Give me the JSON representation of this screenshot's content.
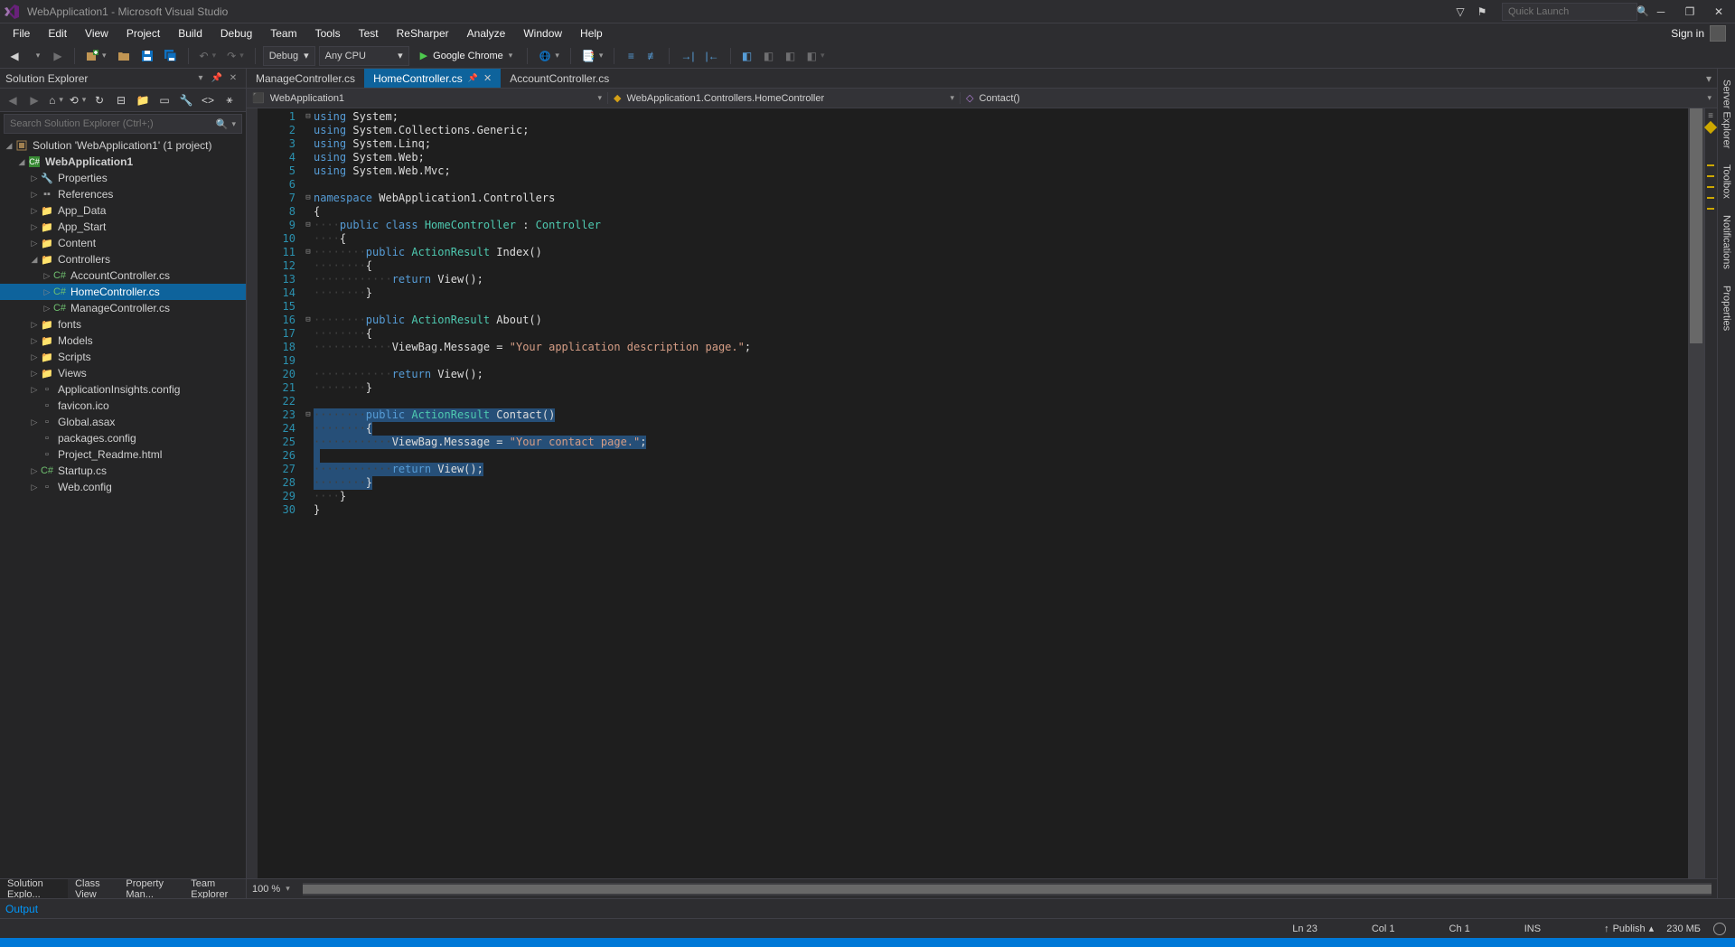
{
  "titlebar": {
    "title": "WebApplication1 - Microsoft Visual Studio",
    "quick_launch_placeholder": "Quick Launch"
  },
  "menubar": {
    "items": [
      "File",
      "Edit",
      "View",
      "Project",
      "Build",
      "Debug",
      "Team",
      "Tools",
      "Test",
      "ReSharper",
      "Analyze",
      "Window",
      "Help"
    ],
    "signin": "Sign in"
  },
  "toolbar": {
    "config": "Debug",
    "platform": "Any CPU",
    "browser": "Google Chrome"
  },
  "solution_explorer": {
    "title": "Solution Explorer",
    "search_placeholder": "Search Solution Explorer (Ctrl+;)",
    "solution": "Solution 'WebApplication1' (1 project)",
    "project": "WebApplication1",
    "nodes": [
      {
        "label": "Properties",
        "indent": 2,
        "chev": "▷",
        "icon": "wrench"
      },
      {
        "label": "References",
        "indent": 2,
        "chev": "▷",
        "icon": "refs"
      },
      {
        "label": "App_Data",
        "indent": 2,
        "chev": "▷",
        "icon": "folder"
      },
      {
        "label": "App_Start",
        "indent": 2,
        "chev": "▷",
        "icon": "folder"
      },
      {
        "label": "Content",
        "indent": 2,
        "chev": "▷",
        "icon": "folder"
      },
      {
        "label": "Controllers",
        "indent": 2,
        "chev": "◢",
        "icon": "folder"
      },
      {
        "label": "AccountController.cs",
        "indent": 3,
        "chev": "▷",
        "icon": "cs"
      },
      {
        "label": "HomeController.cs",
        "indent": 3,
        "chev": "▷",
        "icon": "cs",
        "selected": true
      },
      {
        "label": "ManageController.cs",
        "indent": 3,
        "chev": "▷",
        "icon": "cs"
      },
      {
        "label": "fonts",
        "indent": 2,
        "chev": "▷",
        "icon": "folder"
      },
      {
        "label": "Models",
        "indent": 2,
        "chev": "▷",
        "icon": "folder"
      },
      {
        "label": "Scripts",
        "indent": 2,
        "chev": "▷",
        "icon": "folder"
      },
      {
        "label": "Views",
        "indent": 2,
        "chev": "▷",
        "icon": "folder"
      },
      {
        "label": "ApplicationInsights.config",
        "indent": 2,
        "chev": "▷",
        "icon": "file"
      },
      {
        "label": "favicon.ico",
        "indent": 2,
        "chev": "",
        "icon": "file"
      },
      {
        "label": "Global.asax",
        "indent": 2,
        "chev": "▷",
        "icon": "file"
      },
      {
        "label": "packages.config",
        "indent": 2,
        "chev": "",
        "icon": "file"
      },
      {
        "label": "Project_Readme.html",
        "indent": 2,
        "chev": "",
        "icon": "file"
      },
      {
        "label": "Startup.cs",
        "indent": 2,
        "chev": "▷",
        "icon": "cs"
      },
      {
        "label": "Web.config",
        "indent": 2,
        "chev": "▷",
        "icon": "file"
      }
    ],
    "tabs": [
      "Solution Explo...",
      "Class View",
      "Property Man...",
      "Team Explorer"
    ]
  },
  "editor": {
    "tabs": [
      {
        "label": "ManageController.cs",
        "active": false
      },
      {
        "label": "HomeController.cs",
        "active": true
      },
      {
        "label": "AccountController.cs",
        "active": false
      }
    ],
    "nav": {
      "project": "WebApplication1",
      "class": "WebApplication1.Controllers.HomeController",
      "member": "Contact()"
    },
    "zoom": "100 %",
    "code_lines": [
      {
        "n": 1,
        "fold": "⊟",
        "tokens": [
          {
            "t": "using ",
            "c": "kw"
          },
          {
            "t": "System;",
            "c": ""
          }
        ]
      },
      {
        "n": 2,
        "fold": "",
        "tokens": [
          {
            "t": "using ",
            "c": "kw"
          },
          {
            "t": "System.Collections.Generic;",
            "c": ""
          }
        ]
      },
      {
        "n": 3,
        "fold": "",
        "tokens": [
          {
            "t": "using ",
            "c": "kw"
          },
          {
            "t": "System.Linq;",
            "c": ""
          }
        ]
      },
      {
        "n": 4,
        "fold": "",
        "tokens": [
          {
            "t": "using ",
            "c": "kw"
          },
          {
            "t": "System.Web;",
            "c": ""
          }
        ]
      },
      {
        "n": 5,
        "fold": "",
        "tokens": [
          {
            "t": "using ",
            "c": "kw"
          },
          {
            "t": "System.Web.Mvc;",
            "c": ""
          }
        ]
      },
      {
        "n": 6,
        "fold": "",
        "tokens": []
      },
      {
        "n": 7,
        "fold": "⊟",
        "tokens": [
          {
            "t": "namespace ",
            "c": "kw"
          },
          {
            "t": "WebApplication1.Controllers",
            "c": ""
          }
        ]
      },
      {
        "n": 8,
        "fold": "",
        "tokens": [
          {
            "t": "{",
            "c": ""
          }
        ]
      },
      {
        "n": 9,
        "fold": "⊟",
        "tokens": [
          {
            "t": "    ",
            "c": "dots"
          },
          {
            "t": "public class ",
            "c": "kw"
          },
          {
            "t": "HomeController",
            "c": "type"
          },
          {
            "t": " : ",
            "c": ""
          },
          {
            "t": "Controller",
            "c": "type"
          }
        ]
      },
      {
        "n": 10,
        "fold": "",
        "tokens": [
          {
            "t": "    ",
            "c": "dots"
          },
          {
            "t": "{",
            "c": ""
          }
        ]
      },
      {
        "n": 11,
        "fold": "⊟",
        "tokens": [
          {
            "t": "        ",
            "c": "dots"
          },
          {
            "t": "public ",
            "c": "kw"
          },
          {
            "t": "ActionResult",
            "c": "type"
          },
          {
            "t": " Index()",
            "c": ""
          }
        ]
      },
      {
        "n": 12,
        "fold": "",
        "tokens": [
          {
            "t": "        ",
            "c": "dots"
          },
          {
            "t": "{",
            "c": ""
          }
        ]
      },
      {
        "n": 13,
        "fold": "",
        "tokens": [
          {
            "t": "            ",
            "c": "dots"
          },
          {
            "t": "return ",
            "c": "kw"
          },
          {
            "t": "View();",
            "c": ""
          }
        ]
      },
      {
        "n": 14,
        "fold": "",
        "tokens": [
          {
            "t": "        ",
            "c": "dots"
          },
          {
            "t": "}",
            "c": ""
          }
        ]
      },
      {
        "n": 15,
        "fold": "",
        "tokens": []
      },
      {
        "n": 16,
        "fold": "⊟",
        "tokens": [
          {
            "t": "        ",
            "c": "dots"
          },
          {
            "t": "public ",
            "c": "kw"
          },
          {
            "t": "ActionResult",
            "c": "type"
          },
          {
            "t": " About()",
            "c": ""
          }
        ]
      },
      {
        "n": 17,
        "fold": "",
        "tokens": [
          {
            "t": "        ",
            "c": "dots"
          },
          {
            "t": "{",
            "c": ""
          }
        ]
      },
      {
        "n": 18,
        "fold": "",
        "tokens": [
          {
            "t": "            ",
            "c": "dots"
          },
          {
            "t": "ViewBag.Message = ",
            "c": ""
          },
          {
            "t": "\"Your application description page.\"",
            "c": "str"
          },
          {
            "t": ";",
            "c": ""
          }
        ]
      },
      {
        "n": 19,
        "fold": "",
        "tokens": []
      },
      {
        "n": 20,
        "fold": "",
        "tokens": [
          {
            "t": "            ",
            "c": "dots"
          },
          {
            "t": "return ",
            "c": "kw"
          },
          {
            "t": "View();",
            "c": ""
          }
        ]
      },
      {
        "n": 21,
        "fold": "",
        "tokens": [
          {
            "t": "        ",
            "c": "dots"
          },
          {
            "t": "}",
            "c": ""
          }
        ]
      },
      {
        "n": 22,
        "fold": "",
        "tokens": []
      },
      {
        "n": 23,
        "fold": "⊟",
        "sel": true,
        "tokens": [
          {
            "t": "        ",
            "c": "dots"
          },
          {
            "t": "public ",
            "c": "kw"
          },
          {
            "t": "ActionResult",
            "c": "type"
          },
          {
            "t": " Contact()",
            "c": ""
          }
        ]
      },
      {
        "n": 24,
        "fold": "",
        "sel": true,
        "tokens": [
          {
            "t": "        ",
            "c": "dots"
          },
          {
            "t": "{",
            "c": ""
          }
        ]
      },
      {
        "n": 25,
        "fold": "",
        "sel": true,
        "tokens": [
          {
            "t": "            ",
            "c": "dots"
          },
          {
            "t": "ViewBag.Message = ",
            "c": ""
          },
          {
            "t": "\"Your contact page.\"",
            "c": "str"
          },
          {
            "t": ";",
            "c": ""
          }
        ]
      },
      {
        "n": 26,
        "fold": "",
        "sel": true,
        "tokens": []
      },
      {
        "n": 27,
        "fold": "",
        "sel": true,
        "tokens": [
          {
            "t": "            ",
            "c": "dots"
          },
          {
            "t": "return ",
            "c": "kw"
          },
          {
            "t": "View();",
            "c": ""
          }
        ]
      },
      {
        "n": 28,
        "fold": "",
        "sel": true,
        "tokens": [
          {
            "t": "        ",
            "c": "dots"
          },
          {
            "t": "}",
            "c": ""
          }
        ]
      },
      {
        "n": 29,
        "fold": "",
        "tokens": [
          {
            "t": "    ",
            "c": "dots"
          },
          {
            "t": "}",
            "c": ""
          }
        ]
      },
      {
        "n": 30,
        "fold": "",
        "tokens": [
          {
            "t": "}",
            "c": ""
          }
        ]
      }
    ]
  },
  "right_tabs": [
    "Server Explorer",
    "Toolbox",
    "Notifications",
    "Properties"
  ],
  "output": {
    "title": "Output"
  },
  "statusbar": {
    "ln": "Ln 23",
    "col": "Col 1",
    "ch": "Ch 1",
    "ins": "INS",
    "publish": "Publish",
    "mem": "230 МБ"
  }
}
